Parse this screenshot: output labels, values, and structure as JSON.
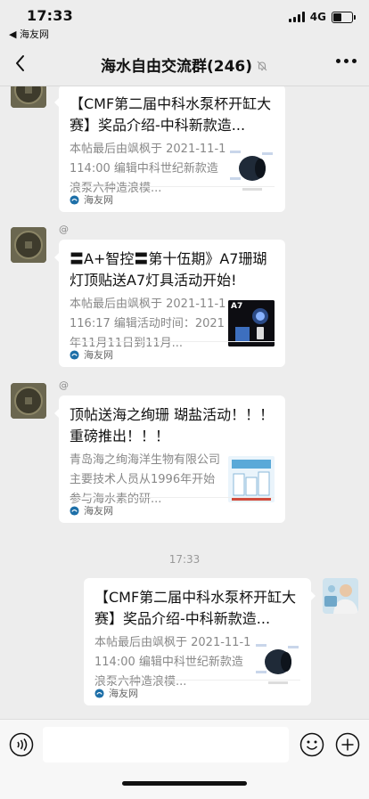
{
  "status": {
    "time": "17:33",
    "back_label": "◀ 海友网",
    "network": "4G"
  },
  "nav": {
    "title": "海水自由交流群(246)",
    "muted": true
  },
  "messages": [
    {
      "sender": "",
      "title": "【CMF第二届中科水泵杯开缸大赛】奖品介绍-中科新款造...",
      "desc": "本帖最后由飒枫于 2021-11-1114:00 编辑中科世纪新款造浪泵六种造浪模...",
      "source": "海友网",
      "thumb": "pump"
    },
    {
      "sender": "@",
      "title": "〓A+智控〓第十伍期》A7珊瑚灯顶贴送A7灯具活动开始!",
      "desc": "本帖最后由飒枫于 2021-11-1116:17 编辑活动时间：2021年11月11日到11月...",
      "source": "海友网",
      "thumb": "a7",
      "thumb_label": "A7"
    },
    {
      "sender": "@",
      "title": "顶帖送海之绚珊 瑚盐活动！！！ 重磅推出！！！",
      "desc": "青岛海之绚海洋生物有限公司主要技术人员从1996年开始参与海水素的研...",
      "source": "海友网",
      "thumb": "salt"
    }
  ],
  "timestamp": "17:33",
  "outgoing": {
    "title": "【CMF第二届中科水泵杯开缸大赛】奖品介绍-中科新款造...",
    "desc": "本帖最后由飒枫于 2021-11-1114:00 编辑中科世纪新款造浪泵六种造浪模...",
    "source": "海友网",
    "thumb": "pump"
  },
  "colors": {
    "background": "#ededed",
    "card": "#ffffff",
    "muted_text": "#888888"
  }
}
